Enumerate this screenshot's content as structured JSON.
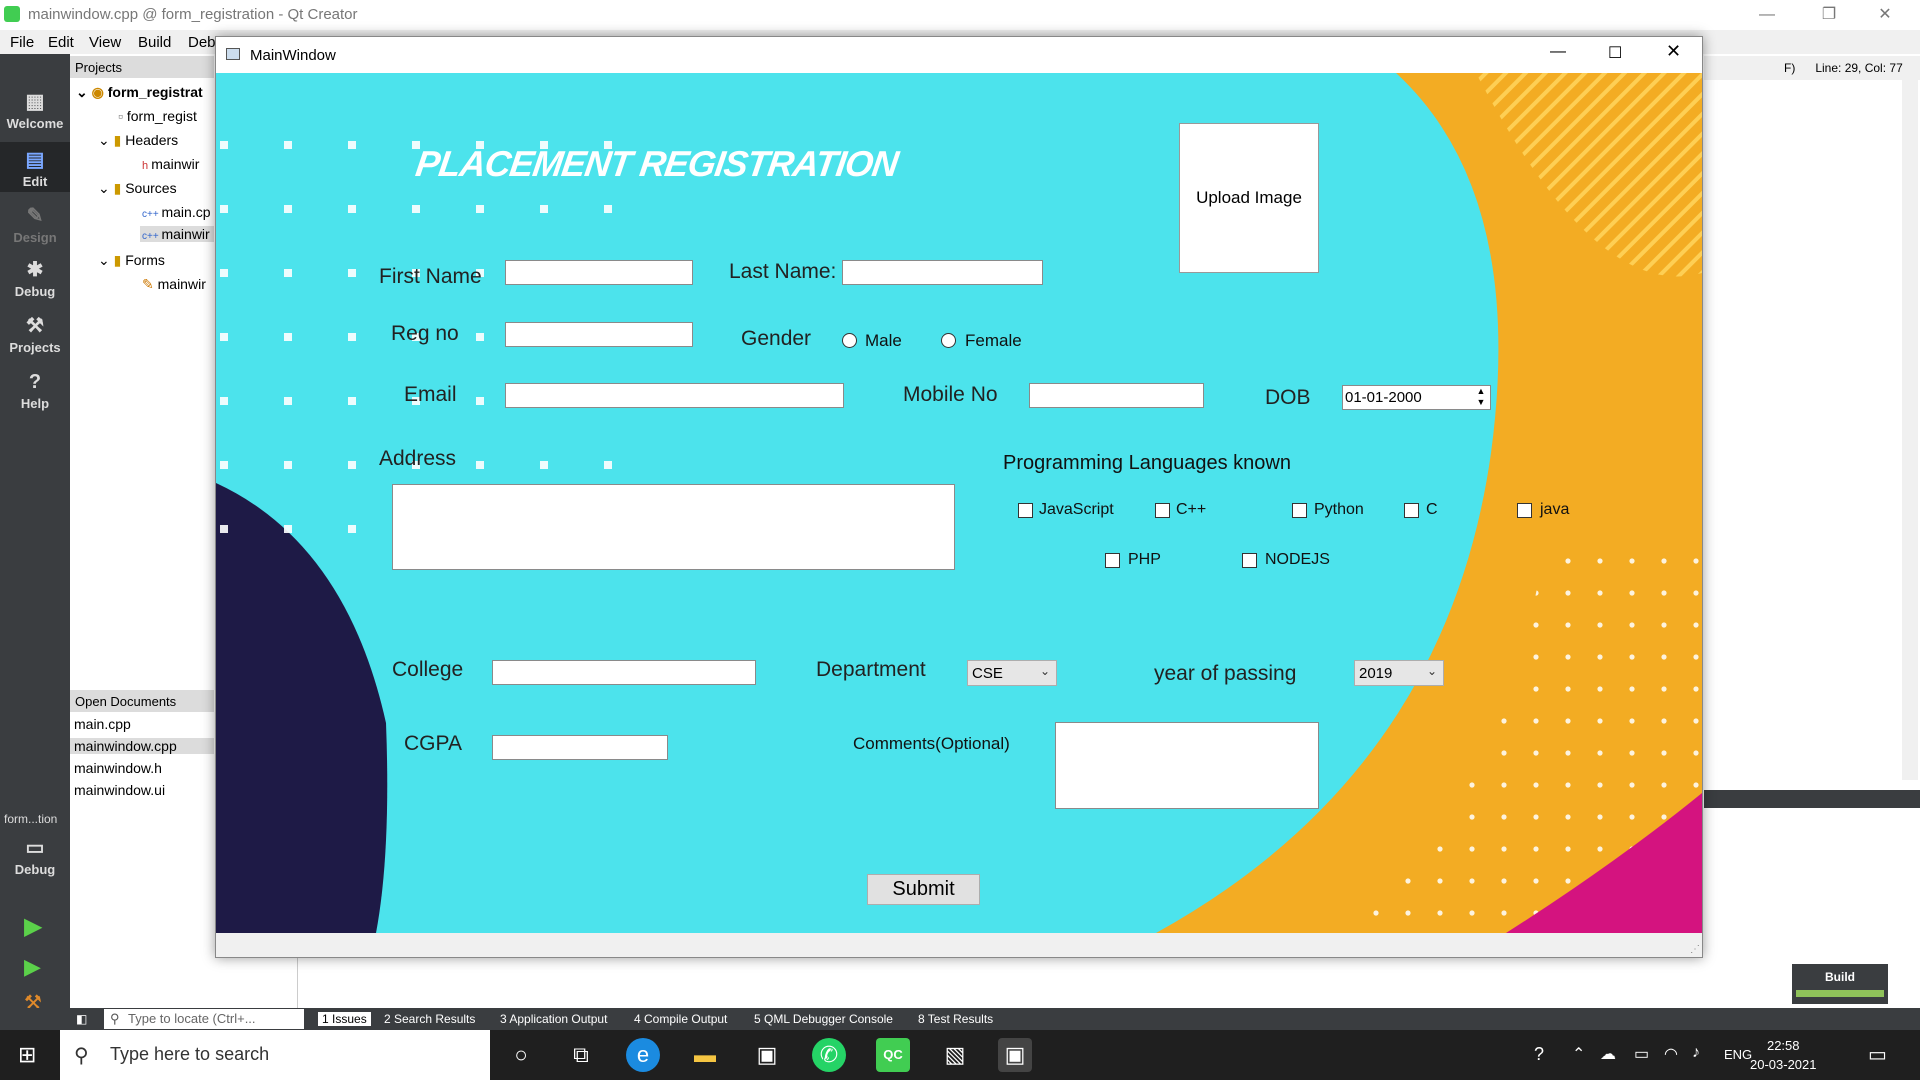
{
  "qt": {
    "title": "mainwindow.cpp @ form_registration - Qt Creator",
    "menu": [
      "File",
      "Edit",
      "View",
      "Build",
      "Deb"
    ],
    "modes": [
      "Welcome",
      "Edit",
      "Design",
      "Debug",
      "Projects",
      "Help"
    ],
    "kit_label": "form...tion",
    "kit_mode": "Debug",
    "projects_header": "Projects",
    "tree": {
      "project": "form_registrat",
      "pro_file": "form_regist",
      "headers": "Headers",
      "header_file": "mainwir",
      "sources": "Sources",
      "source1": "main.cp",
      "source2": "mainwir",
      "forms": "Forms",
      "form_file": "mainwir"
    },
    "open_docs_header": "Open Documents",
    "open_docs": [
      "main.cpp",
      "mainwindow.cpp",
      "mainwindow.h",
      "mainwindow.ui"
    ],
    "editor_top": "F)",
    "line_col": "Line: 29, Col: 77",
    "build_label": "Build",
    "locator_placeholder": "Type to locate (Ctrl+...",
    "output_tabs": [
      "1  Issues",
      "2  Search Results",
      "3  Application Output",
      "4  Compile Output",
      "5  QML Debugger Console",
      "8  Test Results"
    ]
  },
  "taskbar": {
    "search_placeholder": "Type here to search",
    "language": "ENG",
    "time": "22:58",
    "date": "20-03-2021"
  },
  "form": {
    "window_title": "MainWindow",
    "heading": "PLACEMENT REGISTRATION",
    "upload_button": "Upload Image",
    "first_name_label": "First Name",
    "last_name_label": "Last Name:",
    "reg_no_label": "Reg no",
    "gender_label": "Gender",
    "male_label": "Male",
    "female_label": "Female",
    "email_label": "Email",
    "mobile_label": "Mobile No",
    "dob_label": "DOB",
    "dob_value": "01-01-2000",
    "address_label": "Address",
    "prog_lang_label": "Programming Languages known",
    "languages": [
      "JavaScript",
      "C++",
      "Python",
      "C",
      "java",
      "PHP",
      "NODEJS"
    ],
    "college_label": "College",
    "department_label": "Department",
    "department_value": "CSE",
    "year_label": "year of passing",
    "year_value": "2019",
    "cgpa_label": "CGPA",
    "comments_label": "Comments(Optional)",
    "submit_button": "Submit"
  },
  "colors": {
    "background": "#4ce3ec",
    "orange": "#f3ac23",
    "navy": "#1e1a46",
    "magenta": "#d4137f",
    "ide_dark": "#3a3d40"
  }
}
